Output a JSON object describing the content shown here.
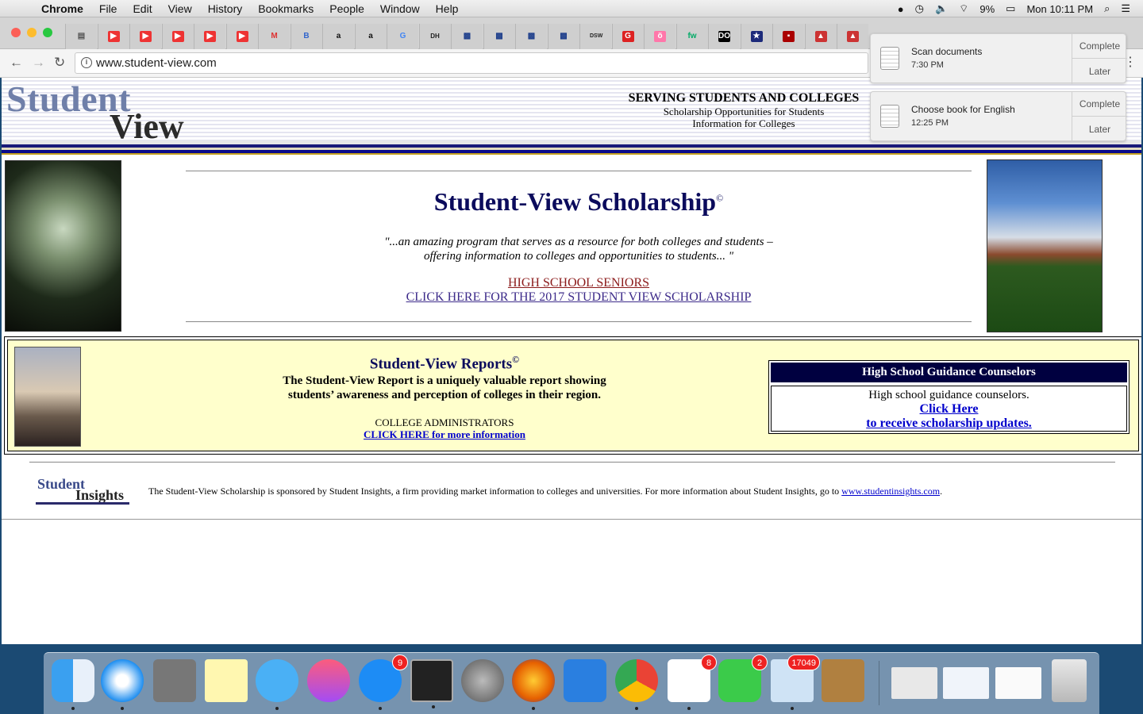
{
  "menubar": {
    "app": "Chrome",
    "items": [
      "File",
      "Edit",
      "View",
      "History",
      "Bookmarks",
      "People",
      "Window",
      "Help"
    ],
    "battery": "9%",
    "clock": "Mon 10:11 PM"
  },
  "browser": {
    "url": "www.student-view.com",
    "tabs": [
      "▤",
      "▶",
      "▶",
      "▶",
      "▶",
      "▶",
      "M",
      "B",
      "a",
      "a",
      "G",
      "DH",
      "▩",
      "▩",
      "▩",
      "▩",
      "DSW",
      "G",
      "ö",
      "fw",
      "DO",
      "★",
      "▪",
      "▲",
      "▲"
    ]
  },
  "site": {
    "logo_line1": "Student",
    "logo_line2": "View",
    "serving_title": "SERVING STUDENTS AND COLLEGES",
    "serving_line1": "Scholarship Opportunities for Students",
    "serving_line2": "Information for Colleges",
    "schol_title": "Student-View Scholarship",
    "copyright": "©",
    "quote_line1": "\"...an amazing program that serves as a resource for both colleges and students –",
    "quote_line2": "offering information to colleges and opportunities to students... \"",
    "seniors_link": "HIGH SCHOOL SENIORS",
    "scholarship_link": "CLICK HERE FOR THE 2017 STUDENT VIEW SCHOLARSHIP",
    "reports_title": "Student-View Reports",
    "reports_line1": "The Student-View Report is a uniquely valuable report showing",
    "reports_line2": "students’ awareness and perception of colleges in their region.",
    "admin_label": "COLLEGE ADMINISTRATORS",
    "admin_link": "CLICK HERE for more information",
    "gc_header": "High School Guidance Counselors",
    "gc_text": "High school guidance counselors.",
    "gc_link1": "Click Here",
    "gc_link2": "to receive scholarship updates.",
    "si_logo1": "Student",
    "si_logo2": "Insights",
    "si_text": "The Student-View Scholarship is sponsored by Student Insights, a firm providing market information to colleges and universities. For more information about Student Insights, go to ",
    "si_link": "www.studentinsights.com",
    "si_end": "."
  },
  "notifications": [
    {
      "title": "Scan documents",
      "time": "7:30 PM",
      "complete": "Complete",
      "later": "Later"
    },
    {
      "title": "Choose book for English",
      "time": "12:25 PM",
      "complete": "Complete",
      "later": "Later"
    }
  ],
  "dock": {
    "badges": {
      "appstore": "9",
      "reminders": "8",
      "facetime": "2",
      "mail": "17049"
    }
  }
}
